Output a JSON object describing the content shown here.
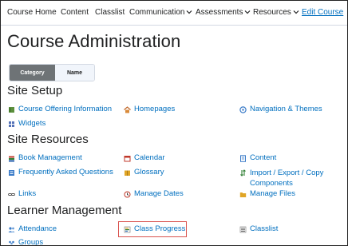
{
  "nav": {
    "items": [
      {
        "label": "Course Home",
        "dropdown": false
      },
      {
        "label": "Content",
        "dropdown": false
      },
      {
        "label": "Classlist",
        "dropdown": false
      },
      {
        "label": "Communication",
        "dropdown": true
      },
      {
        "label": "Assessments",
        "dropdown": true
      },
      {
        "label": "Resources",
        "dropdown": true
      }
    ],
    "edit_course": "Edit Course"
  },
  "page_title": "Course Administration",
  "view_toggle": {
    "category": "Category",
    "name": "Name",
    "selected": "Category"
  },
  "sections": {
    "site_setup": {
      "heading": "Site Setup",
      "links": [
        {
          "label": "Course Offering Information",
          "icon": "book-icon"
        },
        {
          "label": "Homepages",
          "icon": "home-icon"
        },
        {
          "label": "Navigation & Themes",
          "icon": "compass-icon"
        },
        {
          "label": "Widgets",
          "icon": "widgets-icon"
        }
      ]
    },
    "site_resources": {
      "heading": "Site Resources",
      "links": [
        {
          "label": "Book Management",
          "icon": "books-icon"
        },
        {
          "label": "Calendar",
          "icon": "calendar-icon"
        },
        {
          "label": "Content",
          "icon": "content-icon"
        },
        {
          "label": "Frequently Asked Questions",
          "icon": "faq-icon"
        },
        {
          "label": "Glossary",
          "icon": "glossary-icon"
        },
        {
          "label": "Import / Export / Copy Components",
          "icon": "import-export-icon"
        },
        {
          "label": "Links",
          "icon": "link-icon"
        },
        {
          "label": "Manage Dates",
          "icon": "dates-icon"
        },
        {
          "label": "Manage Files",
          "icon": "folder-icon"
        }
      ]
    },
    "learner_management": {
      "heading": "Learner Management",
      "links": [
        {
          "label": "Attendance",
          "icon": "attendance-icon"
        },
        {
          "label": "Class Progress",
          "icon": "progress-icon"
        },
        {
          "label": "Classlist",
          "icon": "classlist-icon"
        },
        {
          "label": "Groups",
          "icon": "groups-icon"
        }
      ]
    }
  },
  "colors": {
    "link": "#006fbf",
    "highlight": "#d9534f",
    "toggle_on": "#6e7376"
  }
}
